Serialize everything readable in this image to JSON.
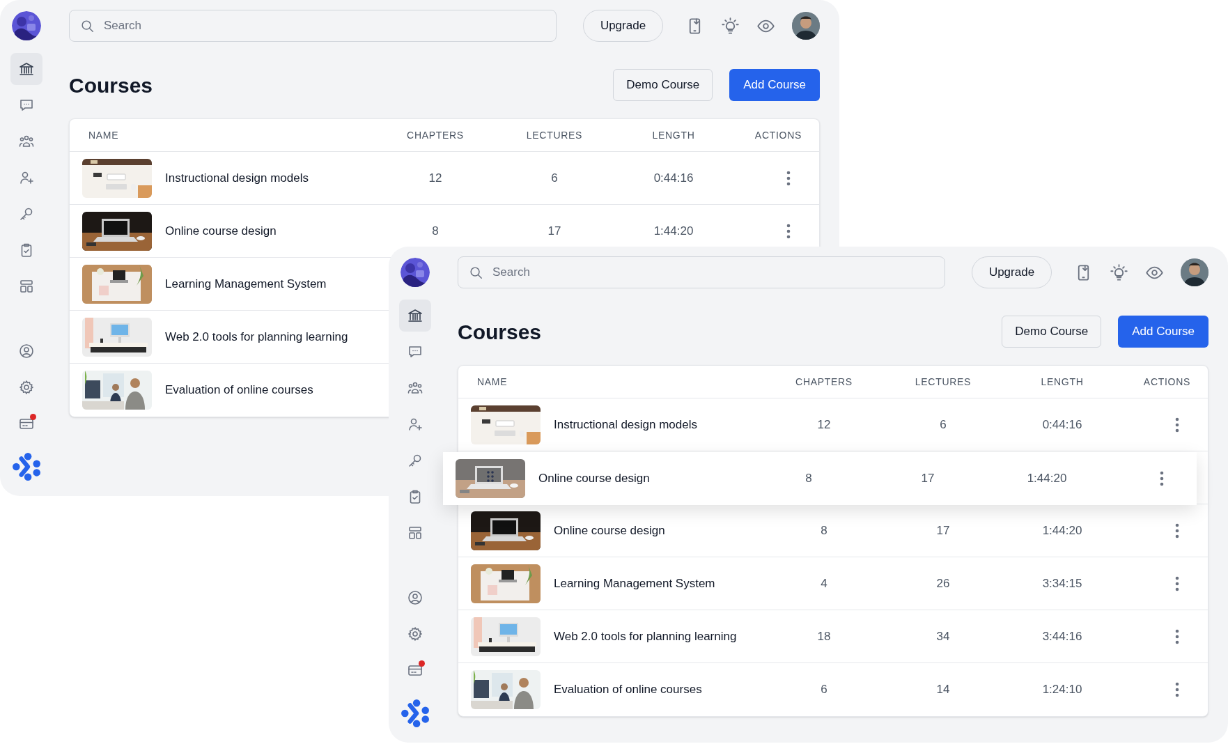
{
  "windows": [
    {
      "search": {
        "placeholder": "Search"
      },
      "upgrade_button": "Upgrade",
      "title": "Courses",
      "buttons": [
        "Demo Course",
        "Add Course"
      ],
      "sidebar": {
        "items": [
          {
            "selected": true,
            "badge": false
          },
          {
            "selected": false,
            "badge": false
          },
          {
            "selected": false,
            "badge": false
          },
          {
            "selected": false,
            "badge": false
          },
          {
            "selected": false,
            "badge": false
          },
          {
            "selected": false,
            "badge": false
          },
          {
            "selected": false,
            "badge": false
          },
          {
            "selected": false,
            "badge": false
          },
          {
            "selected": false,
            "badge": false
          },
          {
            "selected": false,
            "badge": true
          }
        ]
      },
      "table": {
        "columns": [
          "NAME",
          "CHAPTERS",
          "LECTURES",
          "LENGTH",
          "ACTIONS"
        ],
        "rows": [
          {
            "name": "Instructional design models",
            "chapters": "12",
            "lectures": "6",
            "length": "0:44:16"
          },
          {
            "name": "Online course design",
            "chapters": "8",
            "lectures": "17",
            "length": "1:44:20"
          },
          {
            "name": "Learning Management System"
          },
          {
            "name": "Web 2.0 tools for planning learning"
          },
          {
            "name": "Evaluation of online courses"
          }
        ]
      }
    },
    {
      "search": {
        "placeholder": "Search"
      },
      "upgrade_button": "Upgrade",
      "title": "Courses",
      "buttons": [
        "Demo Course",
        "Add Course"
      ],
      "sidebar": {
        "items": [
          {
            "selected": true,
            "badge": false
          },
          {
            "selected": false,
            "badge": false
          },
          {
            "selected": false,
            "badge": false
          },
          {
            "selected": false,
            "badge": false
          },
          {
            "selected": false,
            "badge": false
          },
          {
            "selected": false,
            "badge": false
          },
          {
            "selected": false,
            "badge": false
          },
          {
            "selected": false,
            "badge": false
          },
          {
            "selected": false,
            "badge": false
          },
          {
            "selected": false,
            "badge": true
          }
        ]
      },
      "table": {
        "columns": [
          "NAME",
          "CHAPTERS",
          "LECTURES",
          "LENGTH",
          "ACTIONS"
        ],
        "rows": [
          {
            "name": "Instructional design models",
            "chapters": "12",
            "lectures": "6",
            "length": "0:44:16",
            "dragging": false
          },
          {
            "name": "Online course design",
            "chapters": "8",
            "lectures": "17",
            "length": "1:44:20",
            "dragging": true
          },
          {
            "name": "Online course design",
            "chapters": "8",
            "lectures": "17",
            "length": "1:44:20",
            "dragging": false
          },
          {
            "name": "Learning Management System",
            "chapters": "4",
            "lectures": "26",
            "length": "3:34:15",
            "dragging": false
          },
          {
            "name": "Web 2.0 tools for planning learning",
            "chapters": "18",
            "lectures": "34",
            "length": "3:44:16",
            "dragging": false
          },
          {
            "name": "Evaluation of online courses",
            "chapters": "6",
            "lectures": "14",
            "length": "1:24:10",
            "dragging": false
          }
        ]
      }
    }
  ]
}
